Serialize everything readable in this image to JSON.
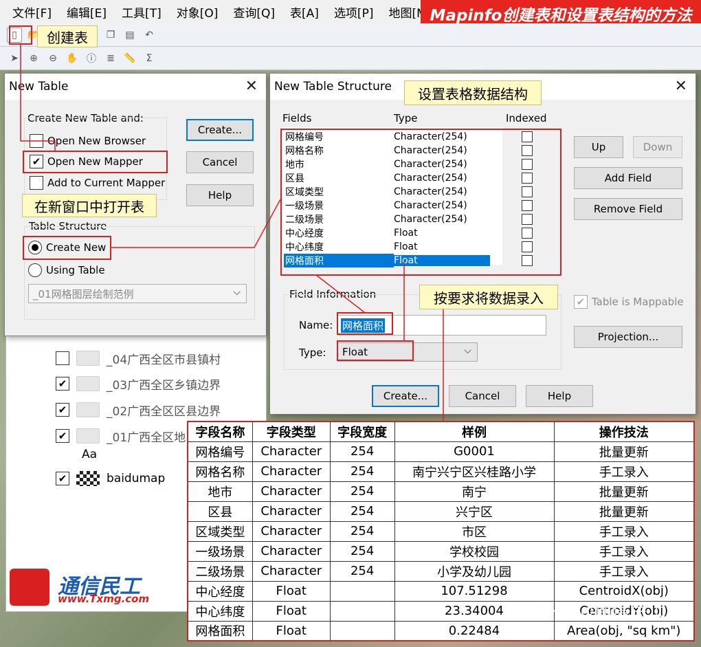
{
  "banner": {
    "title": "Mapinfo创建表和设置表结构的方法"
  },
  "menu": [
    "文件[F]",
    "编辑[E]",
    "工具[T]",
    "对象[O]",
    "查询[Q]",
    "表[A]",
    "选项[P]",
    "地图[M]"
  ],
  "toolbar_icons": [
    "new-table-icon",
    "open-icon",
    "save-icon",
    "print-icon",
    "cut-icon",
    "copy-icon",
    "paste-icon",
    "undo-icon",
    "zoom-in-icon",
    "zoom-out-icon",
    "pan-icon",
    "info-icon",
    "layer-control-icon",
    "ruler-icon",
    "legend-icon",
    "sum-icon"
  ],
  "annotations": {
    "create_table": "创建表",
    "open_in_new_window": "在新窗口中打开表",
    "set_structure": "设置表格数据结构",
    "enter_data": "按要求将数据录入"
  },
  "new_table_dialog": {
    "title": "New Table",
    "create_label": "Create New Table and:",
    "options": [
      {
        "label": "Open New Browser",
        "checked": false
      },
      {
        "label": "Open New Mapper",
        "checked": true
      },
      {
        "label": "Add to Current Mapper",
        "checked": false
      }
    ],
    "buttons": {
      "create": "Create...",
      "cancel": "Cancel",
      "help": "Help"
    },
    "structure_label": "Table Structure",
    "radio_create_new": "Create New",
    "radio_using_table": "Using Table",
    "using_table_value": "_01网格图层绘制范例"
  },
  "structure_dialog": {
    "title": "New Table Structure",
    "headers": {
      "fields": "Fields",
      "type": "Type",
      "indexed": "Indexed"
    },
    "fields": [
      {
        "name": "网格编号",
        "type": "Character(254)"
      },
      {
        "name": "网格名称",
        "type": "Character(254)"
      },
      {
        "name": "地市",
        "type": "Character(254)"
      },
      {
        "name": "区县",
        "type": "Character(254)"
      },
      {
        "name": "区域类型",
        "type": "Character(254)"
      },
      {
        "name": "一级场景",
        "type": "Character(254)"
      },
      {
        "name": "二级场景",
        "type": "Character(254)"
      },
      {
        "name": "中心经度",
        "type": "Float"
      },
      {
        "name": "中心纬度",
        "type": "Float"
      },
      {
        "name": "网格面积",
        "type": "Float"
      }
    ],
    "buttons": {
      "up": "Up",
      "down": "Down",
      "add_field": "Add Field",
      "remove_field": "Remove Field",
      "projection": "Projection...",
      "create": "Create...",
      "cancel": "Cancel",
      "help": "Help"
    },
    "mappable_label": "Table is Mappable",
    "field_info_label": "Field Information",
    "name_label": "Name:",
    "name_value": "网格面积",
    "type_label": "Type:",
    "type_value": "Float"
  },
  "layers": [
    {
      "label": "_04广西全区市县镇村",
      "checked": false
    },
    {
      "label": "_03广西全区乡镇边界",
      "checked": true
    },
    {
      "label": "_02广西全区区县边界",
      "checked": true
    },
    {
      "label": "_01广西全区地",
      "checked": true
    },
    {
      "label": "baidumap",
      "checked": true
    }
  ],
  "label_layer_icon": "Aa",
  "table": {
    "headers": [
      "字段名称",
      "字段类型",
      "字段宽度",
      "样例",
      "操作技法"
    ],
    "rows": [
      [
        "网格编号",
        "Character",
        "254",
        "G0001",
        "批量更新"
      ],
      [
        "网格名称",
        "Character",
        "254",
        "南宁兴宁区兴桂路小学",
        "手工录入"
      ],
      [
        "地市",
        "Character",
        "254",
        "南宁",
        "批量更新"
      ],
      [
        "区县",
        "Character",
        "254",
        "兴宁区",
        "批量更新"
      ],
      [
        "区域类型",
        "Character",
        "254",
        "市区",
        "手工录入"
      ],
      [
        "一级场景",
        "Character",
        "254",
        "学校校园",
        "手工录入"
      ],
      [
        "二级场景",
        "Character",
        "254",
        "小学及幼儿园",
        "手工录入"
      ],
      [
        "中心经度",
        "Float",
        "",
        "107.51298",
        "CentroidX(obj)"
      ],
      [
        "中心纬度",
        "Float",
        "",
        "23.34004",
        "CentroidY(obj)"
      ],
      [
        "网格面积",
        "Float",
        "",
        "0.22484",
        "Area(obj, \"sq km\")"
      ]
    ]
  },
  "logo": {
    "name": "通信民工",
    "url": "www.Txmg.com"
  },
  "watermark": "知乎 @通信民工"
}
